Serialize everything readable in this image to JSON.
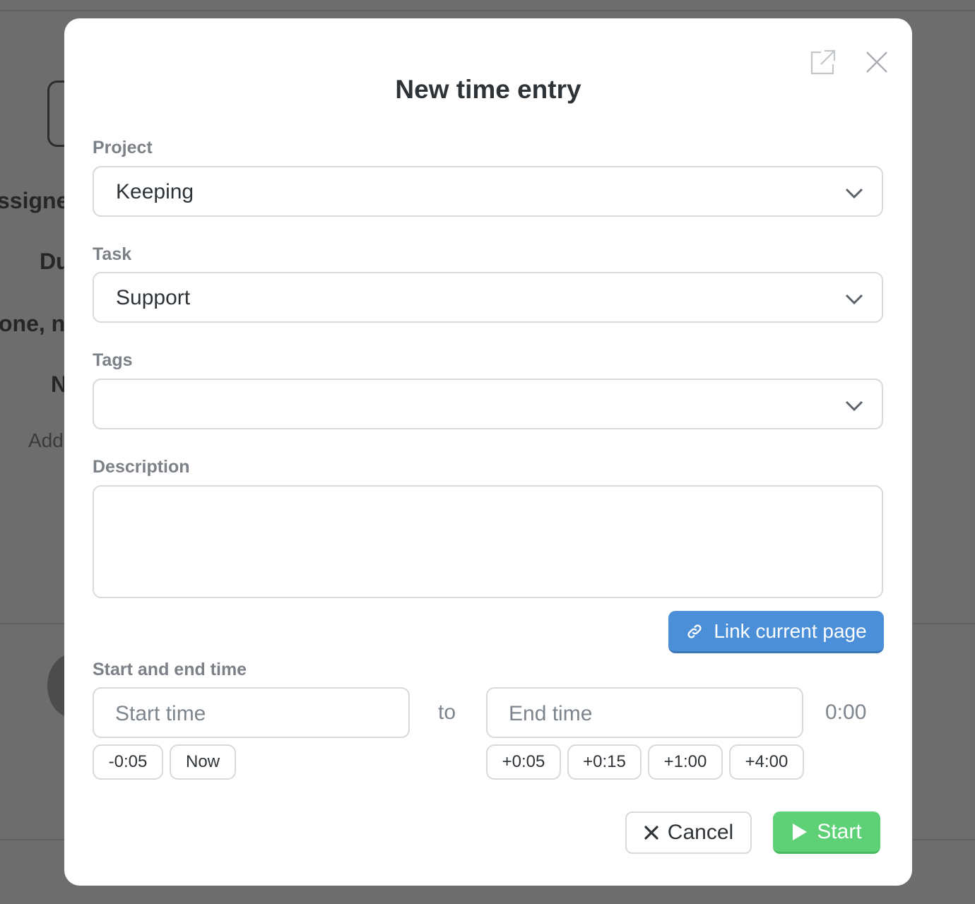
{
  "background": {
    "partial_texts": [
      "ssigne",
      "Du",
      "one, n",
      "N",
      "Add"
    ]
  },
  "modal": {
    "title": "New time entry",
    "icons": {
      "popout": "external-link-icon",
      "close": "close-icon"
    },
    "project": {
      "label": "Project",
      "value": "Keeping"
    },
    "task": {
      "label": "Task",
      "value": "Support"
    },
    "tags": {
      "label": "Tags",
      "value": ""
    },
    "description": {
      "label": "Description",
      "value": ""
    },
    "link_button": {
      "label": "Link current page",
      "icon": "link-icon"
    },
    "time": {
      "label": "Start and end time",
      "start_placeholder": "Start time",
      "to_label": "to",
      "end_placeholder": "End time",
      "duration": "0:00",
      "start_chips": [
        "-0:05",
        "Now"
      ],
      "end_chips": [
        "+0:05",
        "+0:15",
        "+1:00",
        "+4:00"
      ]
    },
    "actions": {
      "cancel": "Cancel",
      "start": "Start"
    },
    "colors": {
      "link_button": "#4b8fd9",
      "start_button": "#5ed177"
    }
  }
}
